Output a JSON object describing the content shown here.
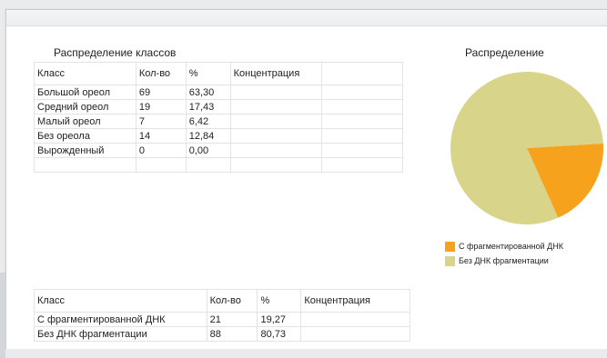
{
  "left_section": {
    "title": "Распределение классов",
    "headers": [
      "Класс",
      "Кол-во",
      "%",
      "Концентрация"
    ],
    "rows": [
      [
        "Большой ореол",
        "69",
        "63,30"
      ],
      [
        "Средний ореол",
        "19",
        "17,43"
      ],
      [
        "Малый ореол",
        "7",
        "6,42"
      ],
      [
        "Без ореола",
        "14",
        "12,84"
      ],
      [
        "Вырожденный",
        "0",
        "0,00"
      ]
    ]
  },
  "bottom_table": {
    "headers": [
      "Класс",
      "Кол-во",
      "%",
      "Концентрация"
    ],
    "rows": [
      [
        "С фрагментированной ДНК",
        "21",
        "19,27"
      ],
      [
        "Без ДНК фрагментации",
        "88",
        "80,73"
      ]
    ]
  },
  "chart_data": {
    "type": "pie",
    "title": "Распределение",
    "categories": [
      "С фрагментированной ДНК",
      "Без ДНК фрагментации"
    ],
    "values": [
      19.27,
      80.73
    ],
    "colors": [
      "#f7a21d",
      "#d8d48a"
    ]
  }
}
